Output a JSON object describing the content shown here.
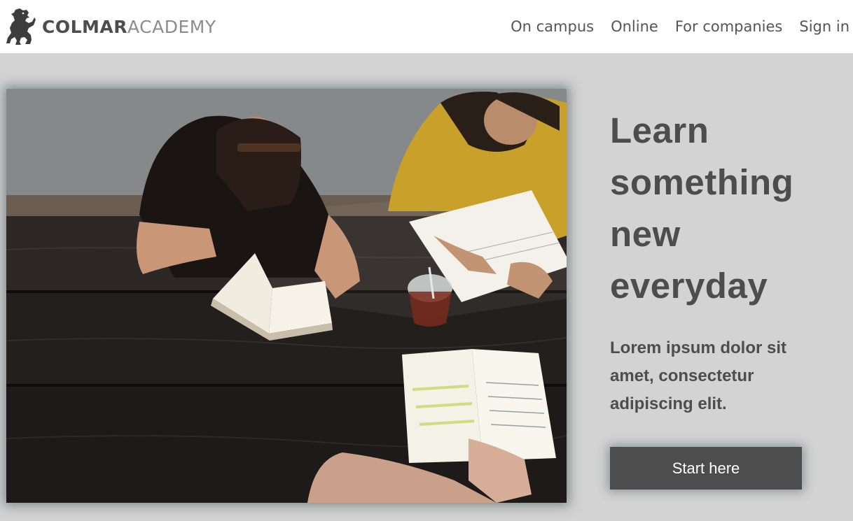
{
  "header": {
    "logo_strong": "COLMAR",
    "logo_light": "ACADEMY",
    "nav": [
      {
        "label": "On campus"
      },
      {
        "label": "Online"
      },
      {
        "label": "For companies"
      },
      {
        "label": "Sign in"
      }
    ]
  },
  "hero": {
    "title_lines": [
      "Learn",
      "something",
      "new",
      "everyday"
    ],
    "subtitle": "Lorem ipsum dolor sit amet, consectetur adipiscing elit.",
    "cta_label": "Start here",
    "photo": "students-studying-at-wooden-table"
  },
  "colors": {
    "background": "#d3d3d3",
    "header": "#ffffff",
    "text_dark": "#4d4d4d",
    "nav_text": "#555555",
    "logo_light": "#8c8c8c",
    "button": "#4d4d4d",
    "button_text": "#ffffff"
  }
}
